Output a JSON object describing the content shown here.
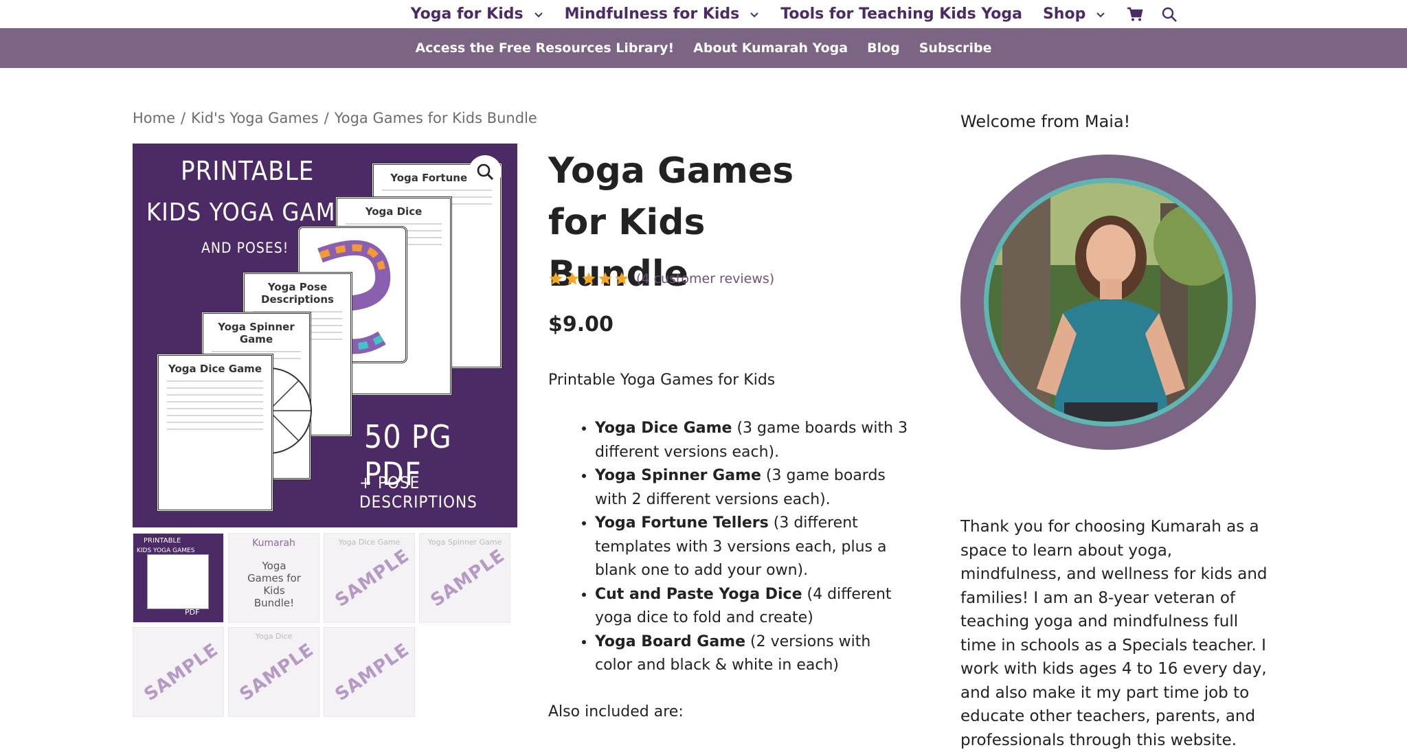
{
  "topnav": {
    "items": [
      {
        "label": "Yoga for Kids",
        "dropdown": true
      },
      {
        "label": "Mindfulness for Kids",
        "dropdown": true
      },
      {
        "label": "Tools for Teaching Kids Yoga",
        "dropdown": false
      },
      {
        "label": "Shop",
        "dropdown": true
      }
    ],
    "icons": [
      "cart-icon",
      "search-icon"
    ]
  },
  "subnav": {
    "links": [
      "Access the Free Resources Library!",
      "About Kumarah Yoga",
      "Blog",
      "Subscribe"
    ]
  },
  "breadcrumb": {
    "items": [
      "Home",
      "Kid's Yoga Games",
      "Yoga Games for Kids Bundle"
    ],
    "separator": "/"
  },
  "product_image": {
    "line1": "PRINTABLE",
    "line2": "KIDS YOGA GAMES",
    "line3": "AND POSES!",
    "pdf": "50 PG PDF",
    "pose": "+ POSE DESCRIPTIONS",
    "sheets": [
      "Yoga Fortune Te",
      "Yoga Dice",
      "Yoga Pose Descriptions",
      "Yoga Spinner Game",
      "Yoga Dice Game"
    ]
  },
  "thumbnails": {
    "stamp": "SAMPLE",
    "title_thumb": "Yoga Games for Kids Bundle!",
    "brand": "Kumarah"
  },
  "product": {
    "title": "Yoga Games for Kids Bundle",
    "rating": 5,
    "reviews_label": "(4 customer reviews)",
    "price": "$9.00",
    "description": "Printable Yoga Games for Kids",
    "features": [
      {
        "name": "Yoga Dice Game",
        "detail": " (3 game boards with 3 different versions each)."
      },
      {
        "name": "Yoga Spinner Game",
        "detail": " (3 game boards with 2 different versions each)."
      },
      {
        "name": "Yoga Fortune Tellers",
        "detail": " (3 different templates with 3 versions each, plus a blank one to add your own)."
      },
      {
        "name": "Cut and Paste Yoga Dice",
        "detail": " (4 different yoga dice to fold and create)"
      },
      {
        "name": "Yoga Board Game",
        "detail": " (2 versions with color and black & white in each)"
      }
    ],
    "also_included": "Also included are:"
  },
  "sidebar": {
    "welcome": "Welcome from Maia!",
    "text": "Thank you for choosing Kumarah as a space to learn about yoga, mindfulness, and wellness for kids and families! I am an 8-year veteran of teaching yoga and mindfulness full time in schools as a Specials teacher. I work with kids ages 4 to 16 every day, and also make it my part time job to educate other teachers, parents, and professionals through this website."
  },
  "colors": {
    "brand_purple": "#4b2a66",
    "subnav_bg": "#7b6484",
    "teal_ring": "#5fb5b4",
    "star": "#f5a623"
  }
}
